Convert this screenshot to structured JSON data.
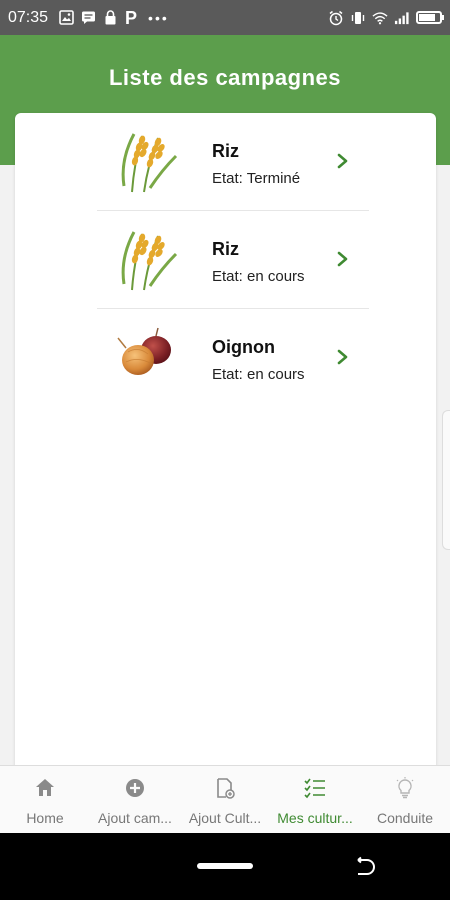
{
  "status_bar": {
    "time": "07:35",
    "left_icons": [
      "image-icon",
      "message-icon",
      "lock-icon",
      "p-icon",
      "more-dots-icon"
    ],
    "p_glyph": "P",
    "dots_glyph": "•••",
    "right_icons": [
      "alarm-icon",
      "vibrate-icon",
      "wifi-icon",
      "signal-icon",
      "battery-icon"
    ],
    "battery_level": 0.8
  },
  "header": {
    "title": "Liste des campagnes",
    "color": "#5c9e4c"
  },
  "campaigns": [
    {
      "name": "Riz",
      "status": "Etat: Terminé",
      "icon": "rice-icon"
    },
    {
      "name": "Riz",
      "status": "Etat: en cours",
      "icon": "rice-icon"
    },
    {
      "name": "Oignon",
      "status": "Etat: en cours",
      "icon": "onion-icon"
    }
  ],
  "bottom_nav": {
    "items": [
      {
        "label": "Home",
        "icon": "home-icon",
        "active": false
      },
      {
        "label": "Ajout cam...",
        "icon": "add-circle-icon",
        "active": false
      },
      {
        "label": "Ajout Cult...",
        "icon": "add-document-icon",
        "active": false
      },
      {
        "label": "Mes cultur...",
        "icon": "checklist-icon",
        "active": true
      },
      {
        "label": "Conduite",
        "icon": "lightbulb-icon",
        "active": false
      }
    ],
    "active_color": "#3f8a32"
  }
}
